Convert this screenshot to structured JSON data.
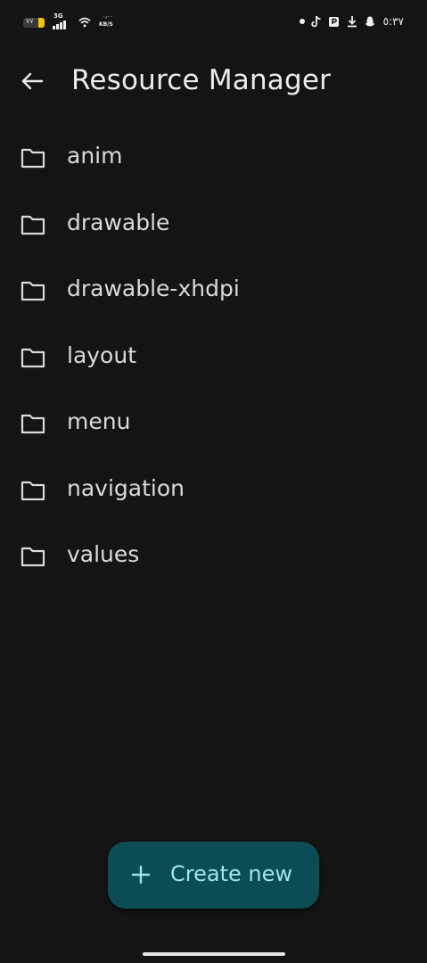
{
  "status_bar": {
    "battery_text": "٧٧",
    "network_type": "3G",
    "speed_value": "٠٫٠٠",
    "speed_unit": "KB/S",
    "clock": "٥:٣٧",
    "icons": [
      "dot-icon",
      "tiktok-icon",
      "app-p-icon",
      "download-icon",
      "snapchat-icon"
    ]
  },
  "header": {
    "title": "Resource Manager"
  },
  "folders": [
    {
      "label": "anim"
    },
    {
      "label": "drawable"
    },
    {
      "label": "drawable-xhdpi"
    },
    {
      "label": "layout"
    },
    {
      "label": "menu"
    },
    {
      "label": "navigation"
    },
    {
      "label": "values"
    }
  ],
  "fab": {
    "label": "Create new"
  },
  "colors": {
    "background": "#141414",
    "fab_background": "#0c4d55",
    "fab_text": "#9ee6ec",
    "text_primary": "#ececec"
  }
}
